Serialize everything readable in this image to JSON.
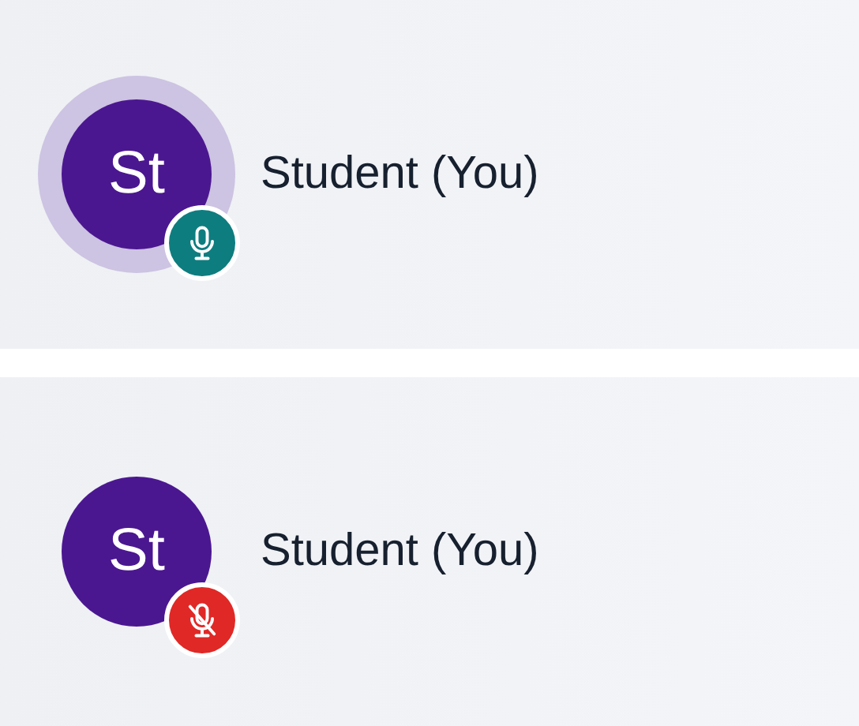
{
  "participants": [
    {
      "initials": "St",
      "name": "Student (You)",
      "speaking": true,
      "muted": false
    },
    {
      "initials": "St",
      "name": "Student (You)",
      "speaking": false,
      "muted": true
    }
  ]
}
